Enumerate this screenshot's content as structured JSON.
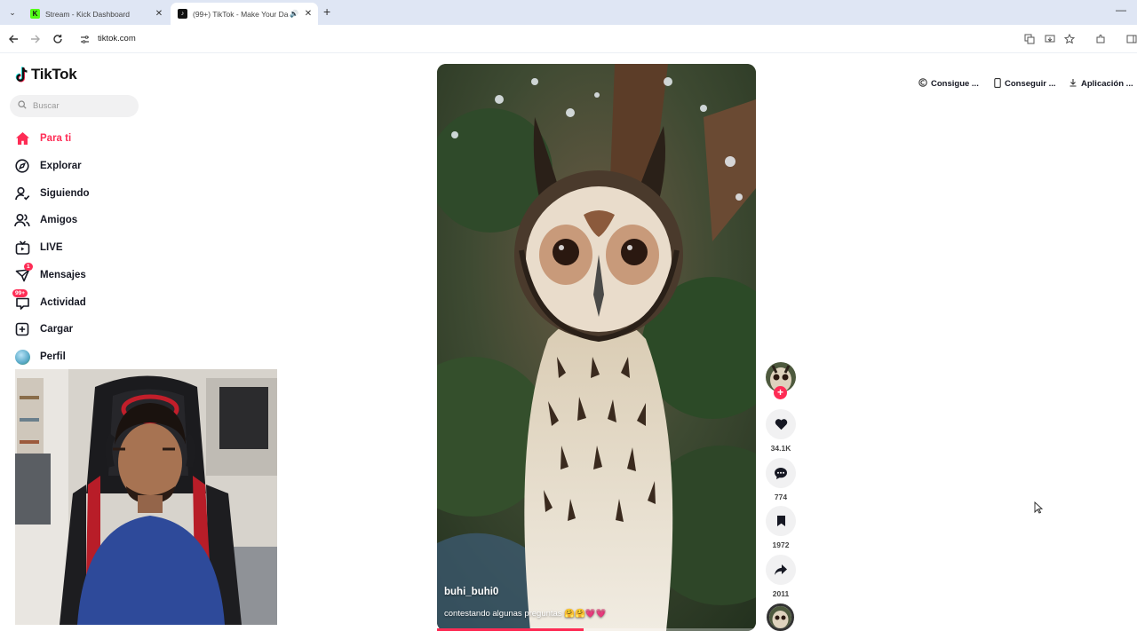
{
  "browser": {
    "tabs": [
      {
        "title": "Stream - Kick Dashboard",
        "favicon": "K"
      },
      {
        "title": "(99+) TikTok - Make Your Da",
        "favicon": "♪"
      }
    ],
    "url": "tiktok.com"
  },
  "sidebar": {
    "logo_text": "TikTok",
    "search_placeholder": "Buscar",
    "items": [
      {
        "label": "Para ti",
        "icon": "home-icon",
        "active": true
      },
      {
        "label": "Explorar",
        "icon": "compass-icon"
      },
      {
        "label": "Siguiendo",
        "icon": "following-icon"
      },
      {
        "label": "Amigos",
        "icon": "friends-icon"
      },
      {
        "label": "LIVE",
        "icon": "live-icon"
      },
      {
        "label": "Mensajes",
        "icon": "messages-icon",
        "badge": "1"
      },
      {
        "label": "Actividad",
        "icon": "activity-icon",
        "badge": "99+"
      },
      {
        "label": "Cargar",
        "icon": "upload-icon"
      },
      {
        "label": "Perfil",
        "icon": "profile-avatar"
      }
    ]
  },
  "top_links": [
    {
      "label": "Consigue ...",
      "icon": "coin-icon"
    },
    {
      "label": "Conseguir ...",
      "icon": "phone-icon"
    },
    {
      "label": "Aplicación ...",
      "icon": "download-icon"
    }
  ],
  "video": {
    "username": "buhi_buhi0",
    "caption": "contestando algunas preguntas 🤗🤗💗💗",
    "progress": 0.46
  },
  "actions": {
    "likes": "34.1K",
    "comments": "774",
    "saves": "1972",
    "shares": "2011"
  },
  "colors": {
    "accent": "#fe2c55",
    "text": "#161823",
    "tabbar": "#dfe6f4"
  }
}
